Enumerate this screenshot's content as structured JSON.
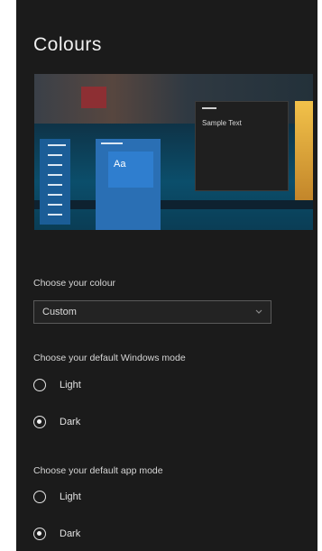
{
  "page": {
    "title": "Colours"
  },
  "preview": {
    "sample_text": "Sample Text",
    "tile_text": "Aa"
  },
  "colour": {
    "label": "Choose your colour",
    "selected": "Custom"
  },
  "windows_mode": {
    "label": "Choose your default Windows mode",
    "options": [
      {
        "label": "Light",
        "checked": false
      },
      {
        "label": "Dark",
        "checked": true
      }
    ]
  },
  "app_mode": {
    "label": "Choose your default app mode",
    "options": [
      {
        "label": "Light",
        "checked": false
      },
      {
        "label": "Dark",
        "checked": true
      }
    ]
  },
  "colors": {
    "background": "#1b1b1b",
    "text": "#e8e8e8",
    "accent": "#2a6fb4"
  }
}
